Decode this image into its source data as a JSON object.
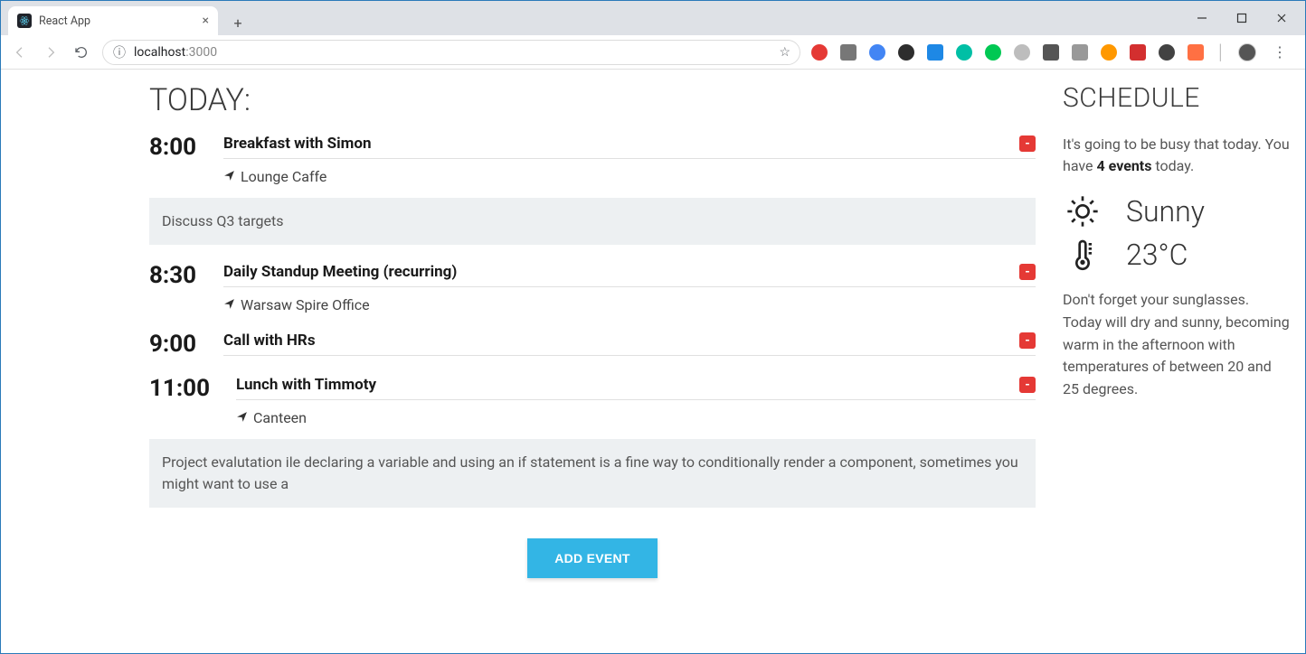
{
  "browser": {
    "tab_title": "React App",
    "url_host": "localhost",
    "url_port": ":3000"
  },
  "today_heading": "TODAY:",
  "events": [
    {
      "time": "8:00",
      "title": "Breakfast with Simon",
      "location": "Lounge Caffe",
      "description": "Discuss Q3 targets"
    },
    {
      "time": "8:30",
      "title": "Daily Standup Meeting (recurring)",
      "location": "Warsaw Spire Office",
      "description": null
    },
    {
      "time": "9:00",
      "title": "Call with HRs",
      "location": null,
      "description": null
    },
    {
      "time": "11:00",
      "title": "Lunch with Timmoty",
      "location": "Canteen",
      "description": "Project evalutation ile declaring a variable and using an if statement is a fine way to conditionally render a component, sometimes you might want to use a"
    }
  ],
  "add_button_label": "ADD EVENT",
  "schedule": {
    "heading": "SCHEDULE",
    "intro_pre": "It's going to be busy that today. You have ",
    "intro_bold": "4 events",
    "intro_post": " today.",
    "condition": "Sunny",
    "temperature": "23°C",
    "note": "Don't forget your sunglasses. Today will dry and sunny, becoming warm in the afternoon with temperatures of between 20 and 25 degrees."
  },
  "remove_label": "-"
}
